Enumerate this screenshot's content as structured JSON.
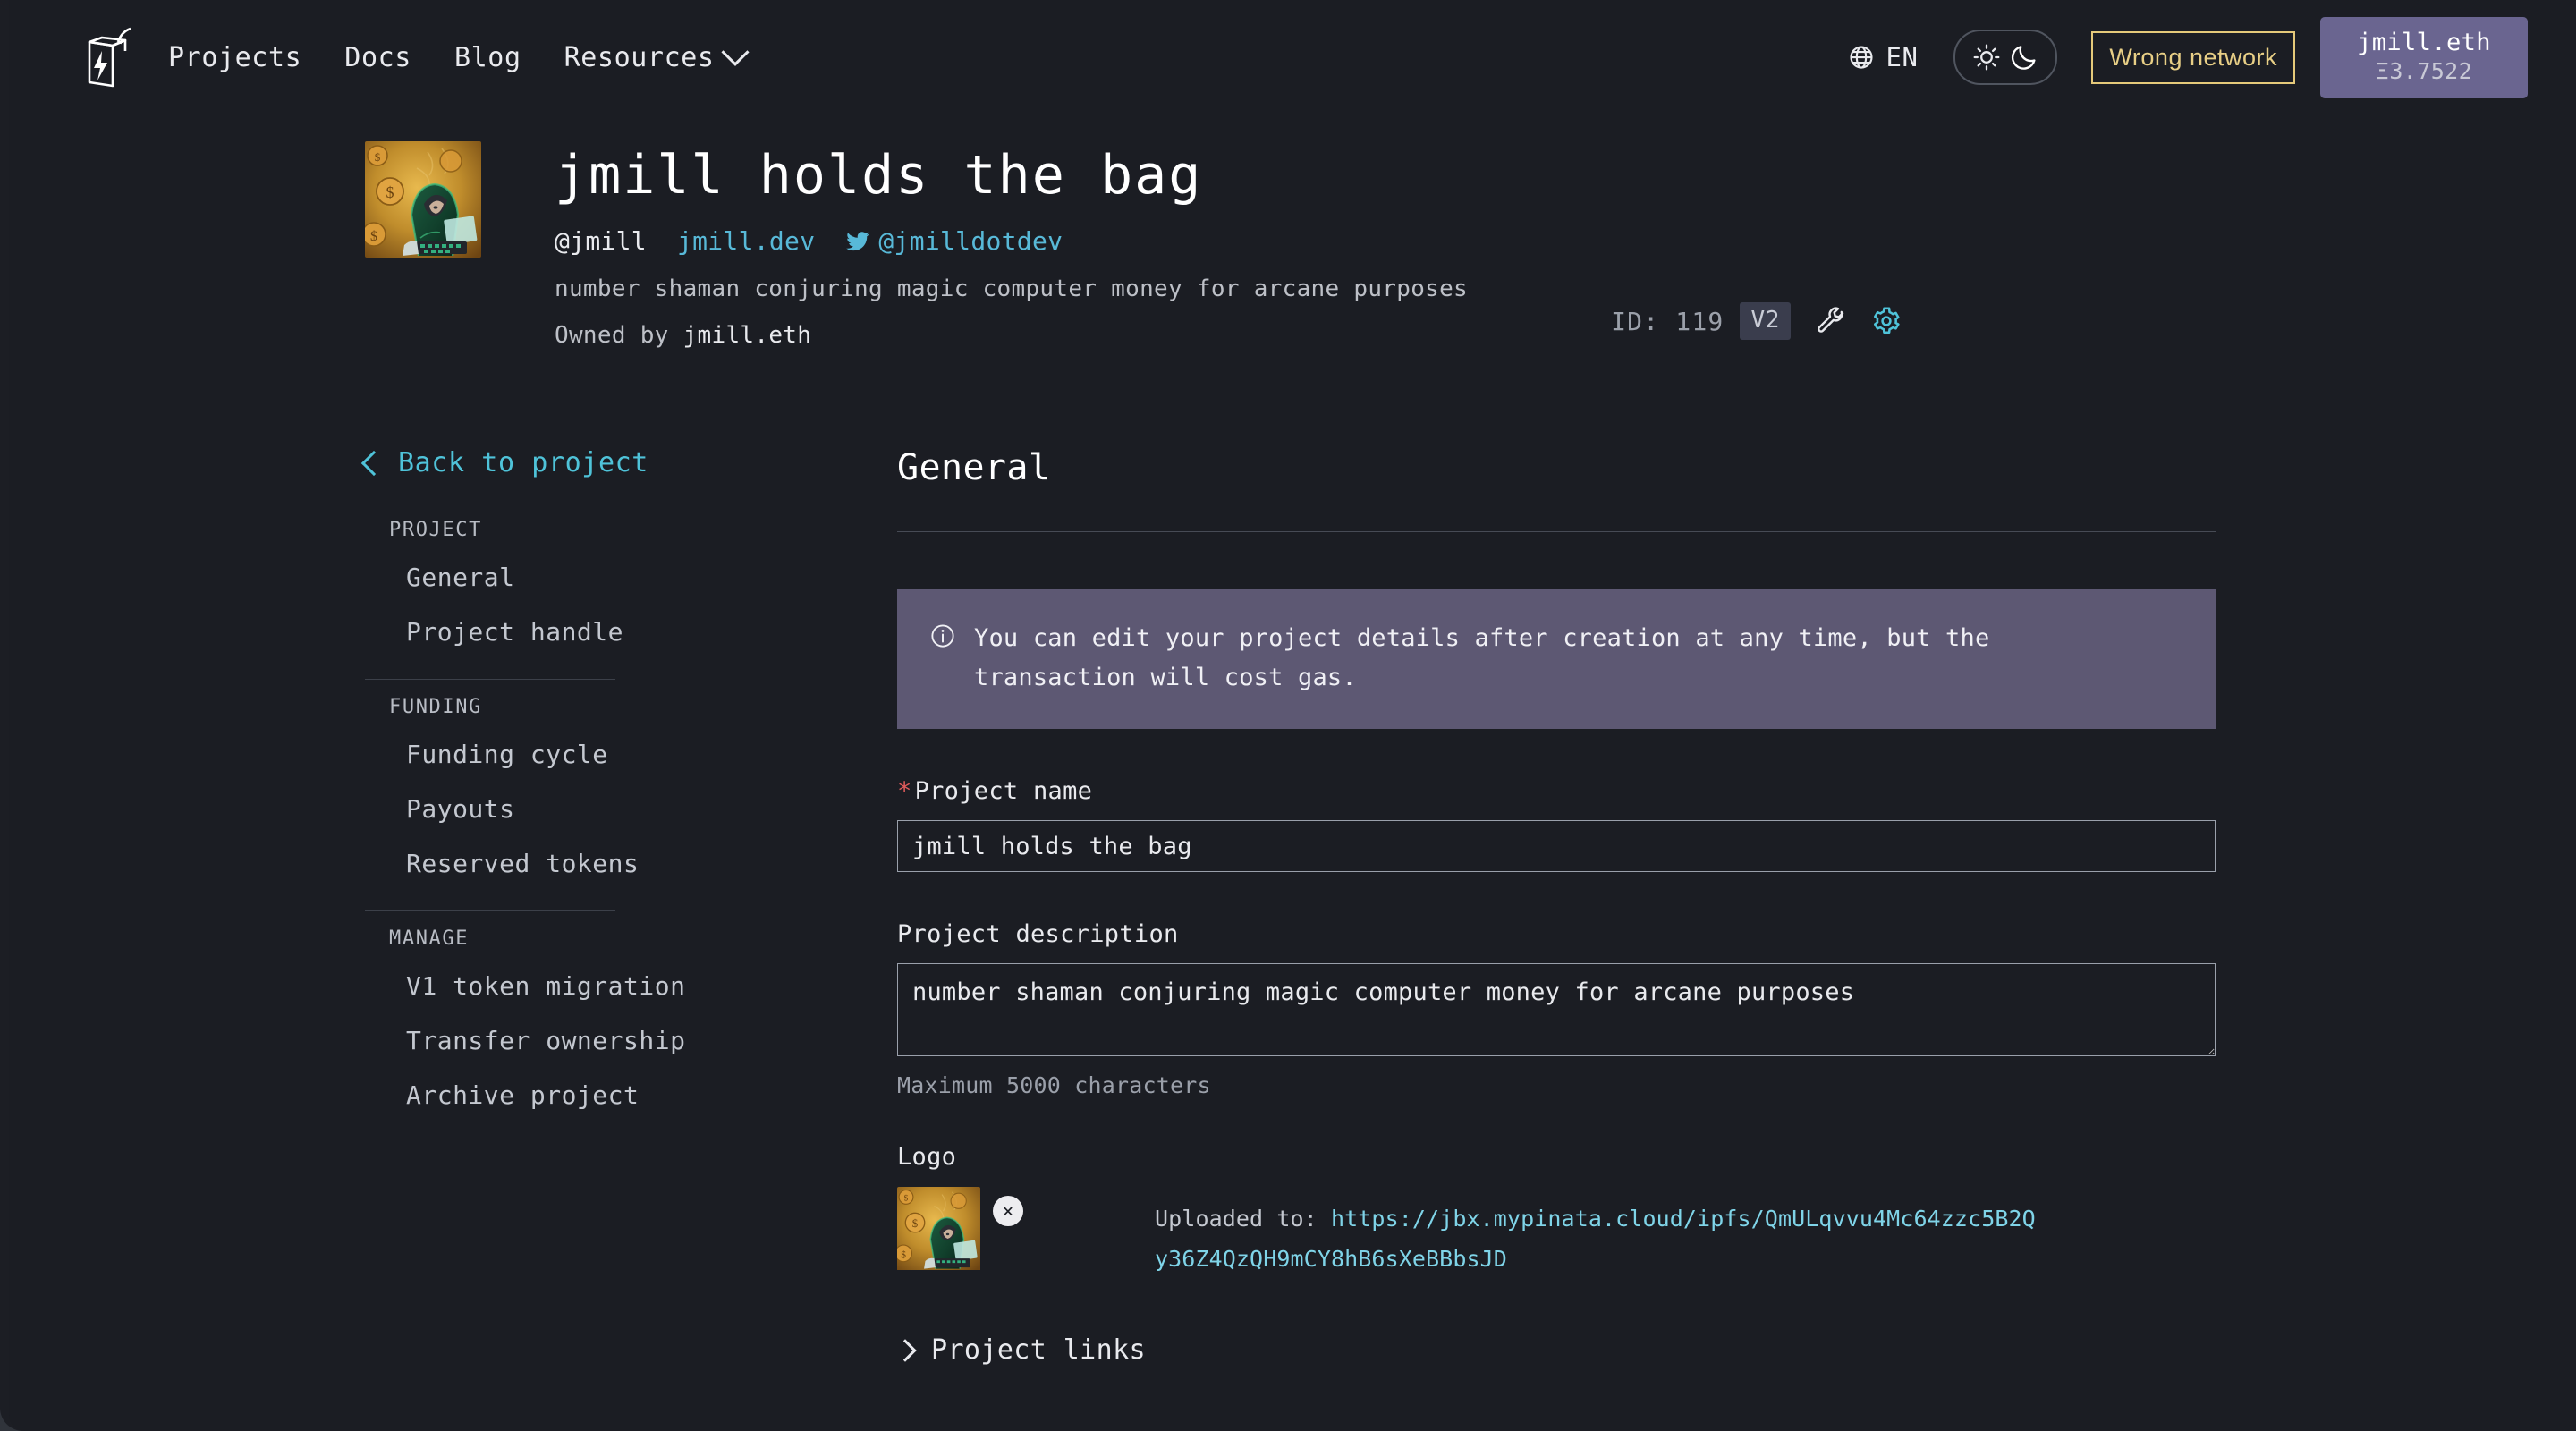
{
  "nav": {
    "logo_icon": "juicebox-logo-icon",
    "links": [
      {
        "label": "Projects"
      },
      {
        "label": "Docs"
      },
      {
        "label": "Blog"
      },
      {
        "label": "Resources",
        "has_dropdown": true
      }
    ],
    "language": {
      "icon": "globe-icon",
      "label": "EN"
    },
    "theme_toggle": {
      "light_icon": "sun-icon",
      "dark_icon": "moon-icon"
    },
    "network_warning": "Wrong network",
    "wallet": {
      "name": "jmill.eth",
      "balance": "Ξ3.7522"
    }
  },
  "project": {
    "avatar_alt": "project-logo",
    "title": "jmill holds the bag",
    "handle": "@jmill",
    "website": "jmill.dev",
    "twitter": {
      "icon": "twitter-icon",
      "handle": "@jmilldotdev"
    },
    "description": "number shaman conjuring magic computer money for arcane purposes",
    "owned_by_prefix": "Owned by ",
    "owner": "jmill.eth",
    "id_label": "ID: 119",
    "version_badge": "V2",
    "tools_icon": "wrench-icon",
    "settings_icon": "gear-icon"
  },
  "sidebar": {
    "back_link": "Back to project",
    "groups": [
      {
        "title": "PROJECT",
        "items": [
          {
            "label": "General"
          },
          {
            "label": "Project handle"
          }
        ]
      },
      {
        "title": "FUNDING",
        "items": [
          {
            "label": "Funding cycle"
          },
          {
            "label": "Payouts"
          },
          {
            "label": "Reserved tokens"
          }
        ]
      },
      {
        "title": "MANAGE",
        "items": [
          {
            "label": "V1 token migration"
          },
          {
            "label": "Transfer ownership"
          },
          {
            "label": "Archive project"
          }
        ]
      }
    ]
  },
  "main": {
    "page_title": "General",
    "callout": {
      "icon": "info-circle-icon",
      "text": "You can edit your project details after creation at any time, but the transaction will cost gas."
    },
    "form": {
      "project_name": {
        "label": "Project name",
        "required_marker": "*",
        "value": "jmill holds the bag",
        "placeholder": "Project name"
      },
      "project_description": {
        "label": "Project description",
        "value": "number shaman conjuring magic computer money for arcane purposes",
        "placeholder": "Project description",
        "hint": "Maximum 5000 characters"
      },
      "logo": {
        "label": "Logo",
        "remove_label": "×",
        "uploaded_prefix": "Uploaded to: ",
        "uploaded_url": "https://jbx.mypinata.cloud/ipfs/QmULqvvu4Mc64zzc5B2Qy36Z4QzQH9mCY8hB6sXeBBbsJD"
      },
      "project_links_accordion": "Project links"
    }
  },
  "colors": {
    "page_bg": "#1b1d23",
    "accent_cyan": "#4fc3d9",
    "link_blue": "#7fd4e8",
    "callout_purple": "#5d5873",
    "wallet_purple": "#6a6590",
    "warning_yellow": "#e5c97a",
    "required_red": "#e05b5b"
  }
}
